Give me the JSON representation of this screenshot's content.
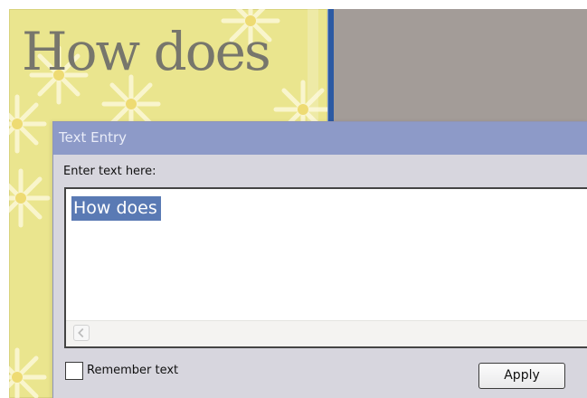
{
  "canvas": {
    "title_text": "How does"
  },
  "dialog": {
    "title": "Text Entry",
    "prompt_label": "Enter text here:",
    "text_value": "How does",
    "remember_label": "Remember text",
    "remember_checked": false,
    "apply_label": "Apply"
  },
  "colors": {
    "canvas_background": "#eae58e",
    "divider": "#2c5aa3",
    "workspace_gray": "#a39c98",
    "dialog_background": "#d7d6de",
    "titlebar": "#8d9ac8",
    "selection": "#5a7ab4"
  },
  "icons": {
    "flower": "daisy-flower-icon",
    "scroll_left": "chevron-left-icon"
  }
}
